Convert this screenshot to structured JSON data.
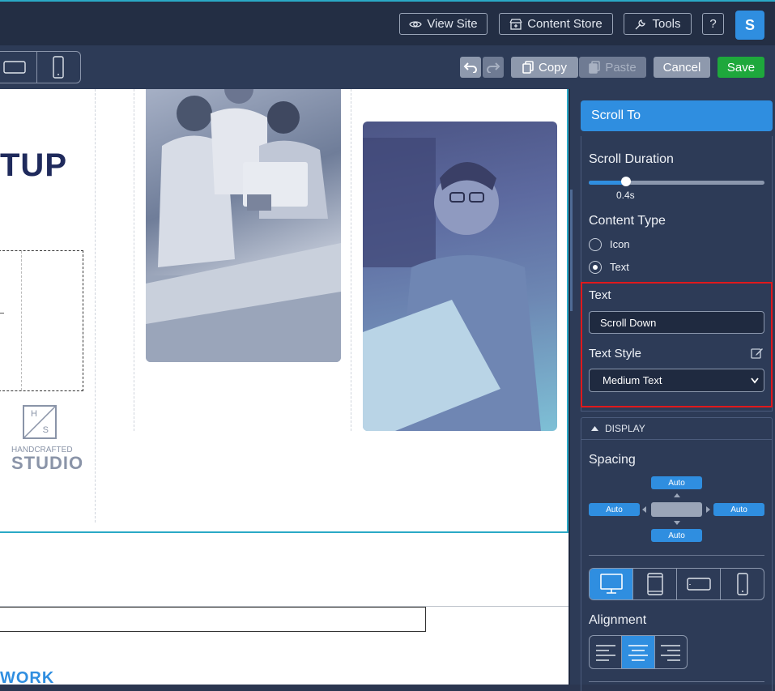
{
  "topbar": {
    "view_site": "View Site",
    "content_store": "Content Store",
    "tools": "Tools",
    "help": "?",
    "avatar": "S"
  },
  "toolbar": {
    "copy": "Copy",
    "paste": "Paste",
    "cancel": "Cancel",
    "save": "Save",
    "colors": {
      "save": "#1ea83c",
      "cancel": "#8e99ad",
      "copy": "#8e99ad"
    }
  },
  "canvas": {
    "heading": "TUP",
    "logo_line1": "H",
    "logo_line2": "S",
    "logo_text1": "HANDCRAFTED",
    "logo_text2": "STUDIO",
    "work": "WORK"
  },
  "panel": {
    "title": "Scroll To",
    "scroll_duration_label": "Scroll Duration",
    "scroll_duration_value": "0.4s",
    "scroll_duration_fraction": 0.21,
    "content_type_label": "Content Type",
    "content_type_options": [
      "Icon",
      "Text"
    ],
    "content_type_selected": "Text",
    "text_label": "Text",
    "text_value": "Scroll Down",
    "text_style_label": "Text Style",
    "text_style_value": "Medium Text",
    "display_label": "DISPLAY",
    "spacing_label": "Spacing",
    "spacing": {
      "top": "Auto",
      "left": "Auto",
      "right": "Auto",
      "bottom": "Auto"
    },
    "alignment_label": "Alignment",
    "alignment_selected": "center"
  }
}
